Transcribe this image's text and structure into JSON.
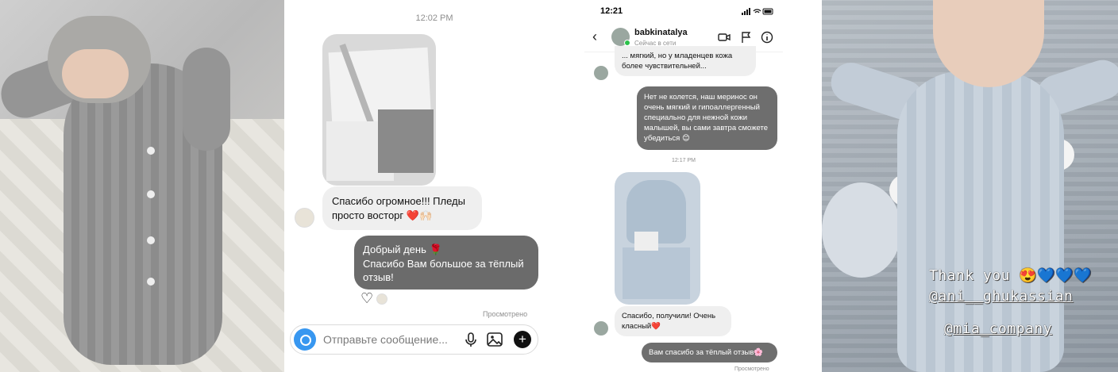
{
  "panel2": {
    "timestamp": "12:02 PM",
    "incoming_text": "Спасибо огромное!!! Пледы просто восторг ❤️🙌🏻",
    "outgoing_text_line1": "Добрый день 🌹",
    "outgoing_text_line2": "Спасибо Вам большое за тёплый отзыв!",
    "reactions": "♡",
    "seen_label": "Просмотрено",
    "composer_placeholder": "Отправьте сообщение...",
    "mic_icon": "microphone-icon",
    "gallery_icon": "image-icon",
    "plus_label": "+"
  },
  "panel3": {
    "status_time": "12:21",
    "username": "babkinatalya",
    "user_status": "Сейчас в сети",
    "back_label": "‹",
    "msg_top": "... мягкий, но у младенцев кожа более чувствительней...",
    "msg_out": "Нет не колется, наш меринос он очень мягкий и гипоаллергенный специально для нежной кожи малышей, вы сами завтра сможете убедиться 😊",
    "timestamp": "12:17 PM",
    "msg_in": "Спасибо, получили! Очень класный❤️",
    "msg_out2": "Вам спасибо за тёплый отзыв🌸",
    "seen_label": "Просмотрено"
  },
  "panel4": {
    "line1": "Thank you 😍💙💙💙",
    "line2": "@ani__ghukassian",
    "line3": "@mia_company"
  },
  "colors": {
    "outgoing_bubble": "#6b6b6b",
    "incoming_bubble": "#efefef",
    "camera_button": "#3897f0",
    "online_dot": "#2bc24a"
  }
}
